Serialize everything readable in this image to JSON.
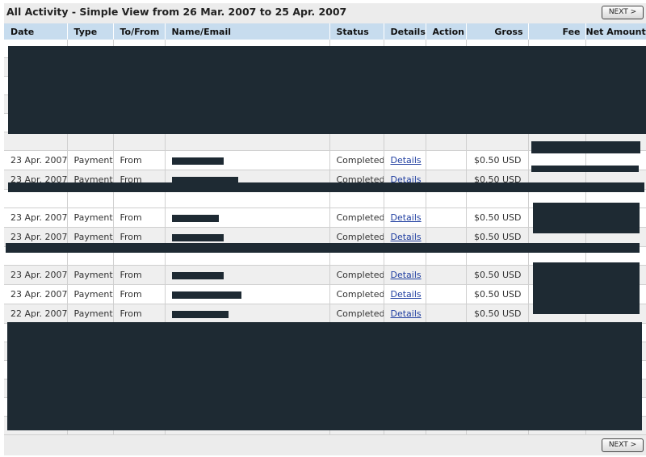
{
  "title": "All Activity - Simple View from 26 Mar. 2007 to 25 Apr. 2007",
  "nav": {
    "next_label": "NEXT >"
  },
  "columns": [
    "Date",
    "Type",
    "To/From",
    "Name/Email",
    "Status",
    "Details",
    "Action",
    "Gross",
    "Fee",
    "Net Amount"
  ],
  "rows": [
    {
      "date": "23 Apr. 2007",
      "type": "Payment",
      "tofrom": "From",
      "status": "Completed",
      "details": "Details",
      "gross": "$0.50 USD"
    },
    {
      "date": "23 Apr. 2007",
      "type": "Payment",
      "tofrom": "From",
      "status": "Completed",
      "details": "Details",
      "gross": "$0.50 USD"
    },
    {
      "date": "23 Apr. 2007",
      "type": "Payment",
      "tofrom": "From",
      "status": "Completed",
      "details": "Details",
      "gross": "$0.50 USD"
    },
    {
      "date": "23 Apr. 2007",
      "type": "Payment",
      "tofrom": "From",
      "status": "Completed",
      "details": "Details",
      "gross": "$0.50 USD"
    },
    {
      "date": "23 Apr. 2007",
      "type": "Payment",
      "tofrom": "From",
      "status": "Completed",
      "details": "Details",
      "gross": "$0.50 USD"
    },
    {
      "date": "23 Apr. 2007",
      "type": "Payment",
      "tofrom": "From",
      "status": "Completed",
      "details": "Details",
      "gross": "$0.50 USD"
    },
    {
      "date": "22 Apr. 2007",
      "type": "Payment",
      "tofrom": "From",
      "status": "Completed",
      "details": "Details",
      "gross": "$0.50 USD"
    }
  ]
}
